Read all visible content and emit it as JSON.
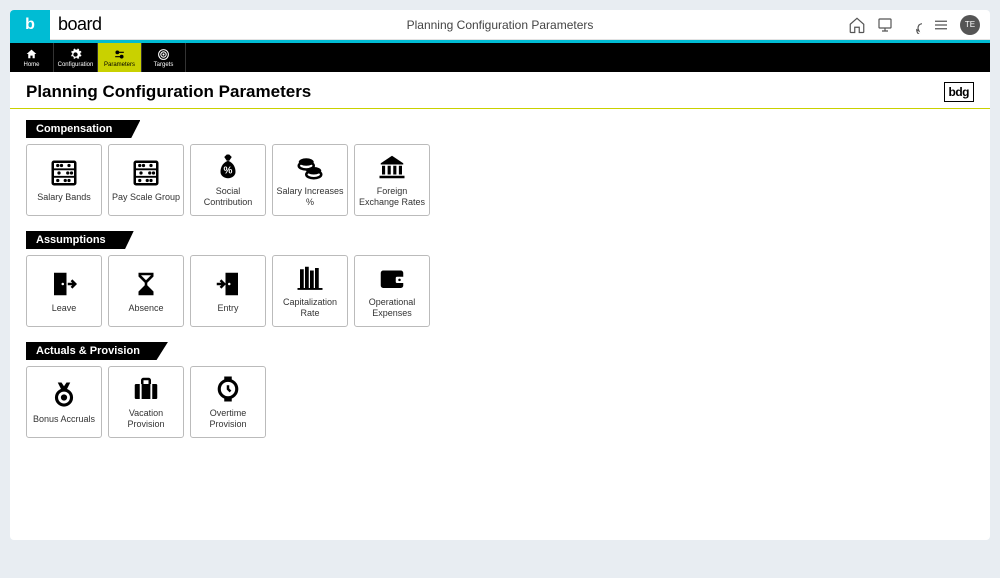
{
  "titlebar": {
    "logo_letter": "b",
    "brand": "board",
    "title": "Planning Configuration Parameters",
    "avatar": "TE"
  },
  "nav": {
    "items": [
      {
        "label": "Home"
      },
      {
        "label": "Configuration"
      },
      {
        "label": "Parameters"
      },
      {
        "label": "Targets"
      }
    ]
  },
  "page": {
    "heading": "Planning Configuration Parameters",
    "corner": "bdg"
  },
  "sections": [
    {
      "title": "Compensation",
      "cards": [
        {
          "label": "Salary Bands",
          "icon": "abacus"
        },
        {
          "label": "Pay Scale Group",
          "icon": "abacus"
        },
        {
          "label": "Social Contribution",
          "icon": "moneybag"
        },
        {
          "label": "Salary Increases %",
          "icon": "coins"
        },
        {
          "label": "Foreign Exchange Rates",
          "icon": "bank"
        }
      ]
    },
    {
      "title": "Assumptions",
      "cards": [
        {
          "label": "Leave",
          "icon": "door-out"
        },
        {
          "label": "Absence",
          "icon": "hourglass"
        },
        {
          "label": "Entry",
          "icon": "door-in"
        },
        {
          "label": "Capitalization Rate",
          "icon": "books"
        },
        {
          "label": "Operational Expenses",
          "icon": "wallet"
        }
      ]
    },
    {
      "title": "Actuals & Provision",
      "cards": [
        {
          "label": "Bonus Accruals",
          "icon": "medal"
        },
        {
          "label": "Vacation Provision",
          "icon": "suitcase"
        },
        {
          "label": "Overtime Provision",
          "icon": "watch"
        }
      ]
    }
  ]
}
